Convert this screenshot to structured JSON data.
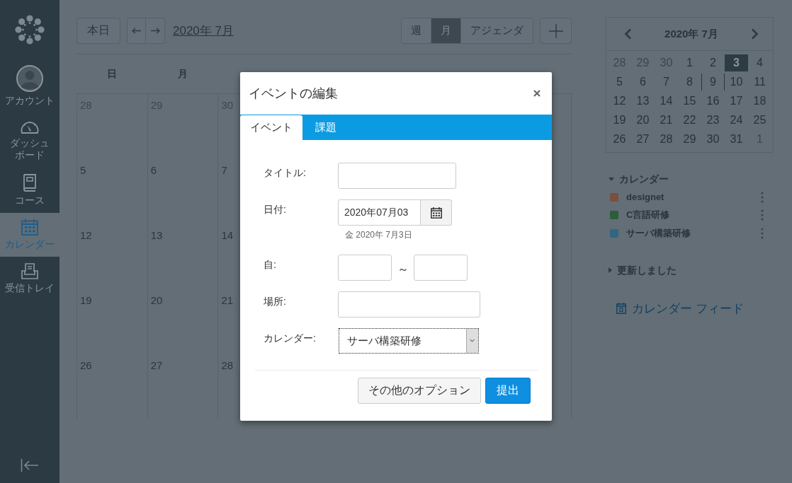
{
  "sidebar": {
    "items": [
      {
        "kind": "account",
        "label": "アカウント",
        "selected": false
      },
      {
        "kind": "dashboard",
        "label": "ダッシュボード",
        "selected": false
      },
      {
        "kind": "courses",
        "label": "コース",
        "selected": false
      },
      {
        "kind": "calendar",
        "label": "カレンダー",
        "selected": true
      },
      {
        "kind": "inbox",
        "label": "受信トレイ",
        "selected": false
      }
    ]
  },
  "header": {
    "today_button": "本日",
    "month_title": "2020年 7月",
    "views": [
      {
        "label": "週",
        "selected": false
      },
      {
        "label": "月",
        "selected": true
      },
      {
        "label": "アジェンダ",
        "selected": false
      }
    ]
  },
  "calendar_grid": {
    "weekdays": [
      "日",
      "月"
    ],
    "weeks": [
      [
        {
          "day": "28",
          "other_month": true
        },
        {
          "day": "29",
          "other_month": true
        },
        {
          "day": "30",
          "other_month": true
        }
      ],
      [
        {
          "day": "5",
          "other_month": false
        },
        {
          "day": "6",
          "other_month": false
        },
        {
          "day": "7",
          "other_month": false
        }
      ],
      [
        {
          "day": "12",
          "other_month": false
        },
        {
          "day": "13",
          "other_month": false
        },
        {
          "day": "14",
          "other_month": false
        }
      ],
      [
        {
          "day": "19",
          "other_month": false
        },
        {
          "day": "20",
          "other_month": false
        },
        {
          "day": "21",
          "other_month": false
        }
      ],
      [
        {
          "day": "26",
          "other_month": false
        },
        {
          "day": "27",
          "other_month": false
        },
        {
          "day": "28",
          "other_month": false
        }
      ]
    ]
  },
  "mini_calendar": {
    "title": "2020年 7月",
    "weeks": [
      [
        {
          "day": "28",
          "other_month": true,
          "selected": false,
          "today": false
        },
        {
          "day": "29",
          "other_month": true,
          "selected": false,
          "today": false
        },
        {
          "day": "30",
          "other_month": true,
          "selected": false,
          "today": false
        },
        {
          "day": "1",
          "other_month": false,
          "selected": false,
          "today": false
        },
        {
          "day": "2",
          "other_month": false,
          "selected": false,
          "today": false
        },
        {
          "day": "3",
          "other_month": false,
          "selected": true,
          "today": false
        },
        {
          "day": "4",
          "other_month": false,
          "selected": false,
          "today": false
        }
      ],
      [
        {
          "day": "5",
          "other_month": false,
          "selected": false,
          "today": false
        },
        {
          "day": "6",
          "other_month": false,
          "selected": false,
          "today": false
        },
        {
          "day": "7",
          "other_month": false,
          "selected": false,
          "today": false
        },
        {
          "day": "8",
          "other_month": false,
          "selected": false,
          "today": false
        },
        {
          "day": "9",
          "other_month": false,
          "selected": false,
          "today": true
        },
        {
          "day": "10",
          "other_month": false,
          "selected": false,
          "today": false
        },
        {
          "day": "11",
          "other_month": false,
          "selected": false,
          "today": false
        }
      ],
      [
        {
          "day": "12",
          "other_month": false,
          "selected": false,
          "today": false
        },
        {
          "day": "13",
          "other_month": false,
          "selected": false,
          "today": false
        },
        {
          "day": "14",
          "other_month": false,
          "selected": false,
          "today": false
        },
        {
          "day": "15",
          "other_month": false,
          "selected": false,
          "today": false
        },
        {
          "day": "16",
          "other_month": false,
          "selected": false,
          "today": false
        },
        {
          "day": "17",
          "other_month": false,
          "selected": false,
          "today": false
        },
        {
          "day": "18",
          "other_month": false,
          "selected": false,
          "today": false
        }
      ],
      [
        {
          "day": "19",
          "other_month": false,
          "selected": false,
          "today": false
        },
        {
          "day": "20",
          "other_month": false,
          "selected": false,
          "today": false
        },
        {
          "day": "21",
          "other_month": false,
          "selected": false,
          "today": false
        },
        {
          "day": "22",
          "other_month": false,
          "selected": false,
          "today": false
        },
        {
          "day": "23",
          "other_month": false,
          "selected": false,
          "today": false
        },
        {
          "day": "24",
          "other_month": false,
          "selected": false,
          "today": false
        },
        {
          "day": "25",
          "other_month": false,
          "selected": false,
          "today": false
        }
      ],
      [
        {
          "day": "26",
          "other_month": false,
          "selected": false,
          "today": false
        },
        {
          "day": "27",
          "other_month": false,
          "selected": false,
          "today": false
        },
        {
          "day": "28",
          "other_month": false,
          "selected": false,
          "today": false
        },
        {
          "day": "29",
          "other_month": false,
          "selected": false,
          "today": false
        },
        {
          "day": "30",
          "other_month": false,
          "selected": false,
          "today": false
        },
        {
          "day": "31",
          "other_month": false,
          "selected": false,
          "today": false
        },
        {
          "day": "1",
          "other_month": true,
          "selected": false,
          "today": false
        }
      ]
    ]
  },
  "calendars": {
    "label": "カレンダー",
    "expanded": true,
    "items": [
      {
        "name": "designet",
        "color": "#7a4f3f"
      },
      {
        "name": "C言語研修",
        "color": "#2b5e3a"
      },
      {
        "name": "サーバ構築研修",
        "color": "#316683"
      }
    ]
  },
  "undated": {
    "label": "更新しました",
    "expanded": false
  },
  "feed_link": "カレンダー フィード",
  "dialog": {
    "title": "イベントの編集",
    "tabs": [
      {
        "label": "イベント",
        "selected": true
      },
      {
        "label": "課題",
        "selected": false
      }
    ],
    "fields": [
      {
        "kind": "text",
        "label": "タイトル:"
      },
      {
        "kind": "date",
        "label": "日付:",
        "value": "2020年07月03",
        "hint": "金 2020年 7月3日"
      },
      {
        "kind": "timerange",
        "label": "自:",
        "separator": "～"
      },
      {
        "kind": "wide",
        "label": "場所:"
      },
      {
        "kind": "select",
        "label": "カレンダー:",
        "value": "サーバ構築研修"
      }
    ],
    "buttons": [
      {
        "label": "その他のオプション",
        "kind": "secondary"
      },
      {
        "label": "提出",
        "kind": "primary"
      }
    ]
  }
}
